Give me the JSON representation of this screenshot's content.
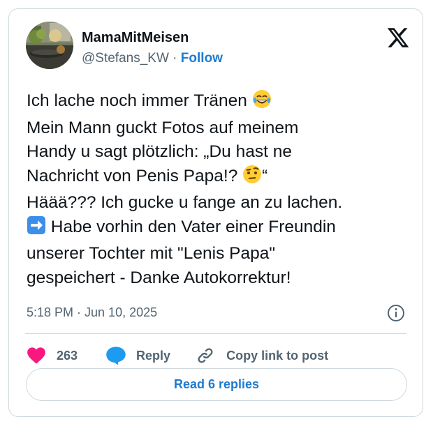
{
  "user": {
    "display_name": "MamaMitMeisen",
    "handle": "@Stefans_KW",
    "separator": " · ",
    "follow_label": "Follow"
  },
  "tweet": {
    "lines": [
      "Ich lache noch immer Tränen ",
      "Mein Mann guckt Fotos auf meinem",
      "Handy u sagt plötzlich: „Du hast ne",
      "Nachricht von Penis Papa!? ",
      "“",
      "Häää??? Ich gucke u fange an zu lachen.",
      " Habe vorhin den Vater einer Freundin",
      "unserer Tochter mit \"Lenis Papa\"",
      "gespeichert - Danke Autokorrektur!"
    ],
    "emojis": [
      "laughing-tears-emoji",
      "raised-eyebrow-emoji",
      "right-arrow-emoji"
    ],
    "timestamp": "5:18 PM · Jun 10, 2025"
  },
  "actions": {
    "like_count": "263",
    "reply_label": "Reply",
    "copy_label": "Copy link to post"
  },
  "footer": {
    "read_replies_label": "Read 6 replies"
  },
  "colors": {
    "accent": "#1d7bd0",
    "like": "#f91880",
    "muted": "#536471",
    "border": "#cfd9de"
  }
}
